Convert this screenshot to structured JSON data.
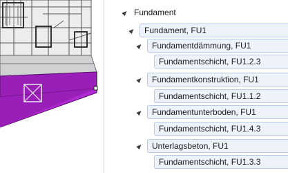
{
  "tree": {
    "root": {
      "label": "Fundament"
    },
    "groups": [
      {
        "label": "Fundament, FU1",
        "children": [
          {
            "label": "Fundamentdämmung, FU1",
            "child": "Fundamentschicht, FU1.2.3"
          },
          {
            "label": "Fundamentkonstruktion, FU1",
            "child": "Fundamentschicht, FU1.1.2"
          },
          {
            "label": "Fundamentunterboden, FU1",
            "child": "Fundamentschicht, FU1.4.3"
          },
          {
            "label": "Unterlagsbeton, FU1",
            "child": "Fundamentschicht, FU1.3.3"
          }
        ]
      }
    ]
  },
  "colors": {
    "slab": "#9a1fb8",
    "selection_fill": "#eef3fb",
    "selection_border": "#b7c9e6"
  }
}
